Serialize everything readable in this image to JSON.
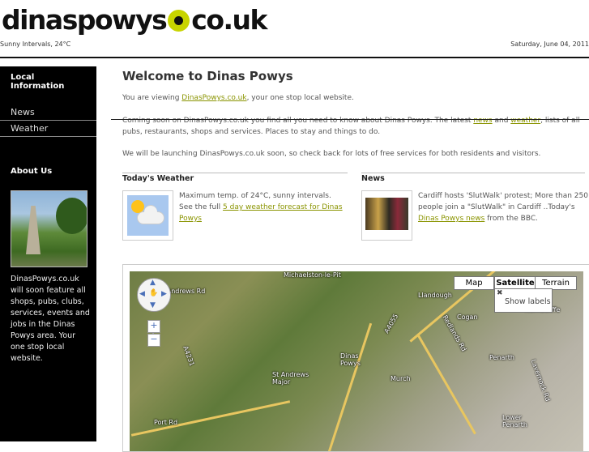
{
  "header": {
    "logo_left": "dinaspowys",
    "logo_right": "co.uk",
    "weather_line": "Sunny Intervals, 24°C",
    "date": "Saturday, June 04, 2011"
  },
  "sidebar": {
    "local_heading": "Local Information",
    "items": [
      {
        "label": "News"
      },
      {
        "label": "Weather"
      }
    ],
    "about_heading": "About Us",
    "about_text": "DinasPowys.co.uk will soon feature all shops, pubs, clubs, services, events and jobs in the Dinas Powys area. Your one stop local website."
  },
  "main": {
    "title": "Welcome to Dinas Powys",
    "intro_prefix": "You are viewing ",
    "intro_link": "DinasPowys.co.uk",
    "intro_suffix": ", your one stop local website.",
    "coming_prefix": "Coming soon on DinasPowys.co.uk you find all you need to know about Dinas Powys. The latest ",
    "coming_link_news": "news",
    "coming_and": " and ",
    "coming_link_weather": "weather",
    "coming_suffix": ", lists of all pubs, restaurants, shops and services. Places to stay and things to do.",
    "launch_text": "We will be launching DinasPowys.co.uk soon, so check back for lots of free services for both residents and visitors."
  },
  "weather": {
    "heading": "Today's Weather",
    "text": "Maximum temp. of 24°C, sunny intervals. See the full ",
    "link": "5 day weather forecast for Dinas Powys"
  },
  "news": {
    "heading": "News",
    "text": " Cardiff hosts 'SlutWalk' protest; More than 250 people join a \"SlutWalk\" in Cardiff ..Today's ",
    "link": "Dinas Powys news",
    "suffix": " from the BBC."
  },
  "map": {
    "types": [
      {
        "label": "Map"
      },
      {
        "label": "Satellite"
      },
      {
        "label": "Terrain"
      }
    ],
    "show_labels": "Show labels",
    "zoom_in": "+",
    "zoom_out": "−",
    "places": [
      {
        "name": "Llandough"
      },
      {
        "name": "Cogan"
      },
      {
        "name": "Dinas\nPowys"
      },
      {
        "name": "Murch"
      },
      {
        "name": "St Andrews\nMajor"
      },
      {
        "name": "Penarth"
      },
      {
        "name": "Lower\nPenarth"
      },
      {
        "name": "Port Rd"
      },
      {
        "name": "A4055"
      },
      {
        "name": "A4231"
      },
      {
        "name": "Nornacliffe"
      },
      {
        "name": "Michaelston-le-Pit"
      },
      {
        "name": "Lavernock Rd"
      },
      {
        "name": "Redlands Rd"
      },
      {
        "name": "St Andrews Rd"
      }
    ]
  }
}
